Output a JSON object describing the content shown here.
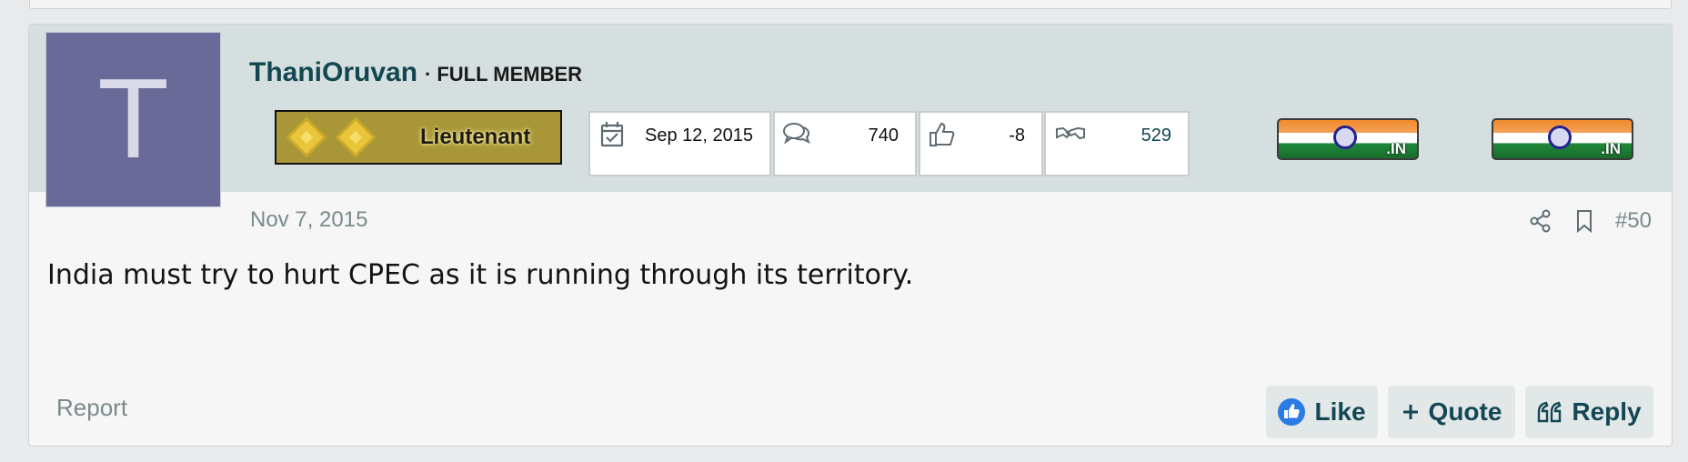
{
  "post": {
    "avatar_letter": "T",
    "username": "ThaniOruvan",
    "separator": "·",
    "user_title": "FULL MEMBER",
    "rank": {
      "label": "Lieutenant",
      "icon": "rank-diamonds-icon"
    },
    "stats": [
      {
        "name": "join-date",
        "icon": "calendar-check-icon",
        "value": "Sep 12, 2015"
      },
      {
        "name": "messages",
        "icon": "speech-bubbles-icon",
        "value": "740"
      },
      {
        "name": "reaction-score",
        "icon": "thumbs-up-icon",
        "value": "-8"
      },
      {
        "name": "trophy-points",
        "icon": "handshake-icon",
        "value": "529"
      }
    ],
    "flags": [
      {
        "label": ".IN",
        "icon": "india-flag-icon"
      },
      {
        "label": ".IN",
        "icon": "india-flag-icon"
      }
    ],
    "date": "Nov 7, 2015",
    "post_number": "#50",
    "message": "India must try to hurt CPEC as it is running through its territory.",
    "actions": {
      "report": "Report",
      "like": "Like",
      "quote": "Quote",
      "reply": "Reply"
    }
  },
  "colors": {
    "header_bg": "#d6dfdf",
    "avatar_bg": "#6a6a99",
    "username": "#124650",
    "button_bg": "#e2e7e8",
    "muted_text": "#7a8a8c"
  }
}
